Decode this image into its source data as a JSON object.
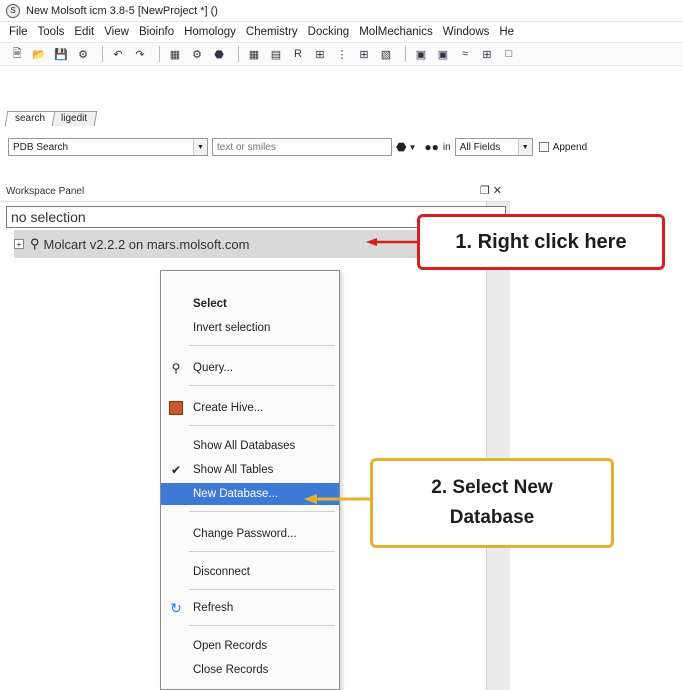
{
  "window": {
    "title": "New Molsoft icm 3.8-5  [NewProject *] ()"
  },
  "menubar": {
    "items": [
      "File",
      "Tools",
      "Edit",
      "View",
      "Bioinfo",
      "Homology",
      "Chemistry",
      "Docking",
      "MolMechanics",
      "Windows",
      "He"
    ]
  },
  "tabs": [
    {
      "label": "search"
    },
    {
      "label": "ligedit"
    }
  ],
  "search": {
    "source_value": "PDB Search",
    "query_placeholder": "text or smiles",
    "in_label": "in",
    "field_value": "All Fields",
    "append_label": "Append"
  },
  "workspace": {
    "title": "Workspace Panel",
    "controls": "❐ ✕",
    "selection_text": "no selection",
    "tree_node": "Molcart v2.2.2 on mars.molsoft.com"
  },
  "context_menu": {
    "items": [
      {
        "label": "Select"
      },
      {
        "label": "Invert selection"
      },
      {
        "label": "Query..."
      },
      {
        "label": "Create Hive..."
      },
      {
        "label": "Show All Databases"
      },
      {
        "label": "Show All Tables"
      },
      {
        "label": "New Database..."
      },
      {
        "label": "Change Password..."
      },
      {
        "label": "Disconnect"
      },
      {
        "label": "Refresh"
      },
      {
        "label": "Open Records"
      },
      {
        "label": "Close Records"
      }
    ]
  },
  "annotations": {
    "step1": "1. Right click here",
    "step2": "2. Select New Database",
    "step1_color": "#d61f1f",
    "step2_color": "#e3b12a"
  },
  "colors": {
    "highlight": "#3f79d6"
  }
}
